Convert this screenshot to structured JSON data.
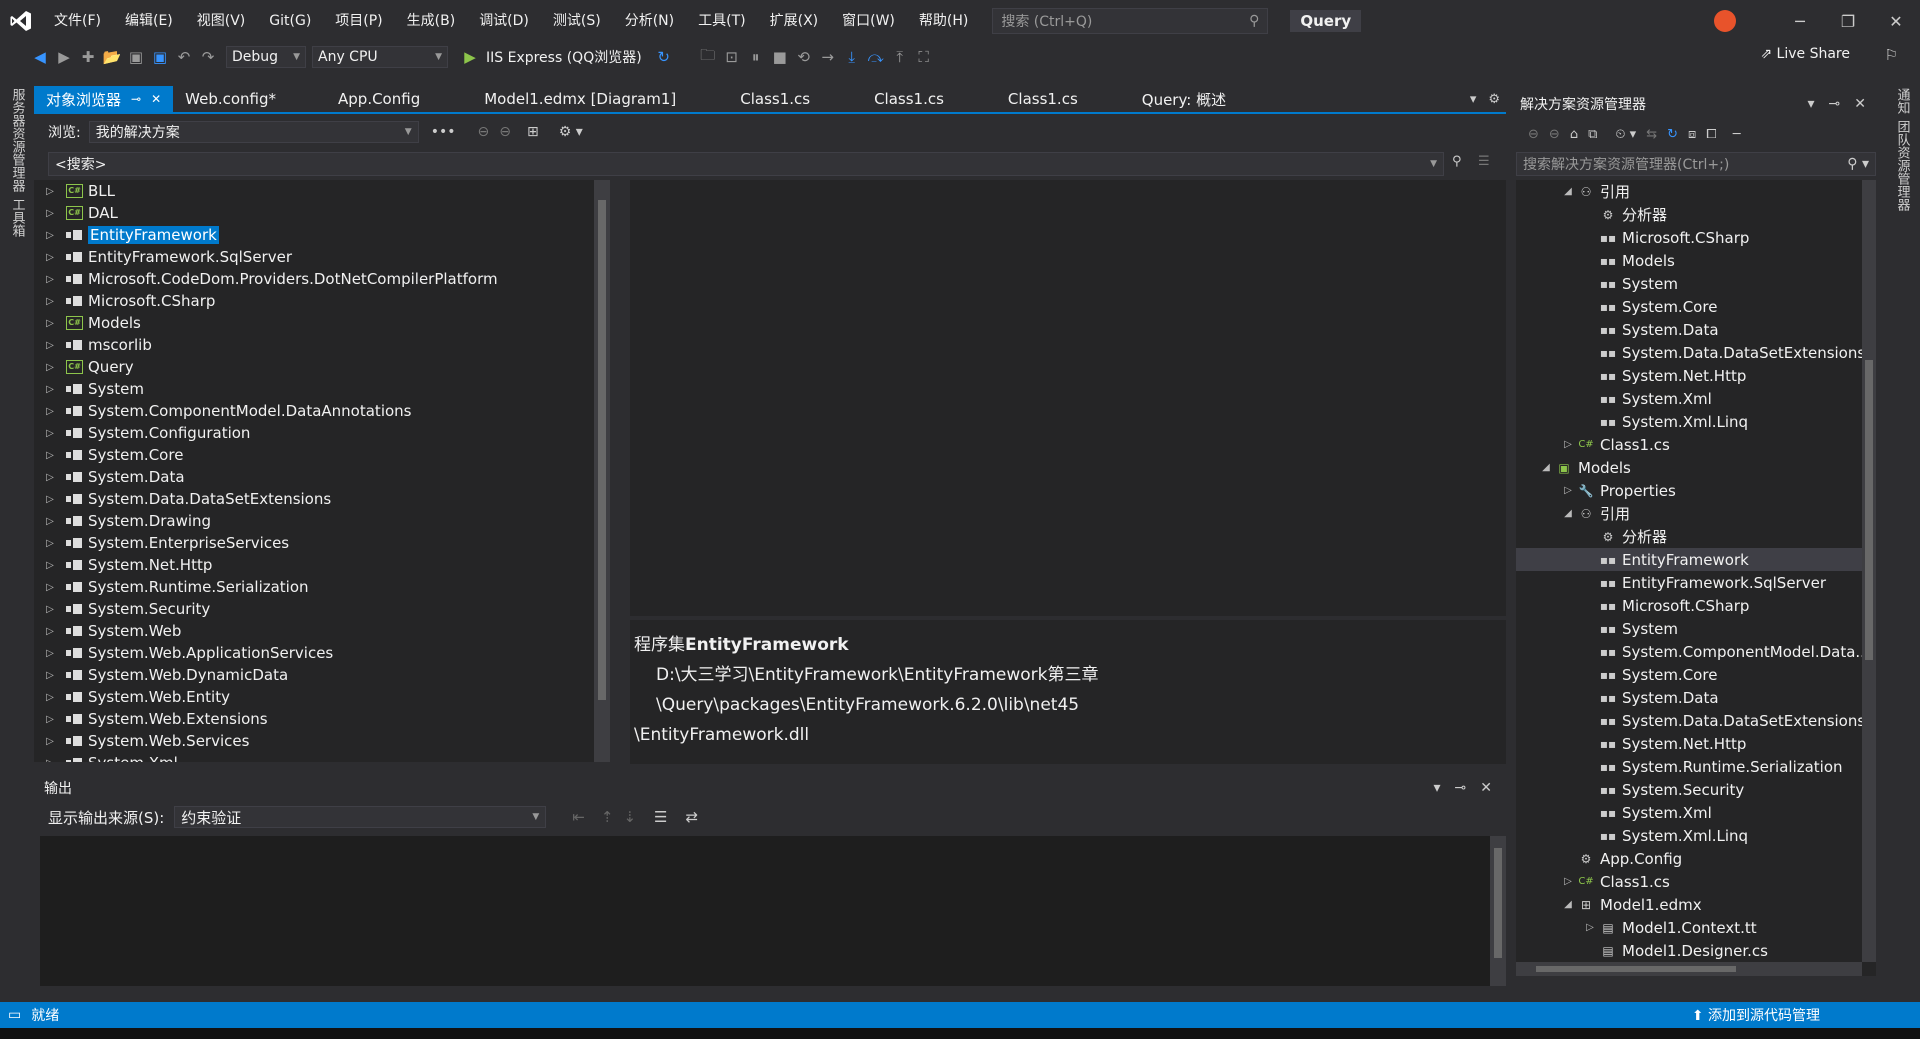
{
  "menu": [
    "文件(F)",
    "编辑(E)",
    "视图(V)",
    "Git(G)",
    "项目(P)",
    "生成(B)",
    "调试(D)",
    "测试(S)",
    "分析(N)",
    "工具(T)",
    "扩展(X)",
    "窗口(W)",
    "帮助(H)"
  ],
  "search": {
    "placeholder": "搜索 (Ctrl+Q)"
  },
  "project_title": "Query",
  "toolbar": {
    "config": "Debug",
    "platform": "Any CPU",
    "run_target": "IIS Express (QQ浏览器)",
    "live_share": "Live Share"
  },
  "left_strip": [
    "服务器资源管理器",
    "工具箱"
  ],
  "right_strip": [
    "通知",
    "团队资源管理器"
  ],
  "tabs": [
    {
      "label": "对象浏览器"
    },
    {
      "label": "Web.config*"
    },
    {
      "label": "App.Config"
    },
    {
      "label": "Model1.edmx [Diagram1]"
    },
    {
      "label": "Class1.cs"
    },
    {
      "label": "Class1.cs"
    },
    {
      "label": "Class1.cs"
    },
    {
      "label": "Query: 概述"
    }
  ],
  "browse": {
    "label": "浏览:",
    "value": "我的解决方案",
    "search_placeholder": "<搜索>"
  },
  "object_tree": [
    {
      "name": "BLL",
      "kind": "cs"
    },
    {
      "name": "DAL",
      "kind": "cs"
    },
    {
      "name": "EntityFramework",
      "kind": "asm",
      "selected": true
    },
    {
      "name": "EntityFramework.SqlServer",
      "kind": "asm"
    },
    {
      "name": "Microsoft.CodeDom.Providers.DotNetCompilerPlatform",
      "kind": "asm"
    },
    {
      "name": "Microsoft.CSharp",
      "kind": "asm"
    },
    {
      "name": "Models",
      "kind": "cs"
    },
    {
      "name": "mscorlib",
      "kind": "asm"
    },
    {
      "name": "Query",
      "kind": "cs"
    },
    {
      "name": "System",
      "kind": "asm"
    },
    {
      "name": "System.ComponentModel.DataAnnotations",
      "kind": "asm"
    },
    {
      "name": "System.Configuration",
      "kind": "asm"
    },
    {
      "name": "System.Core",
      "kind": "asm"
    },
    {
      "name": "System.Data",
      "kind": "asm"
    },
    {
      "name": "System.Data.DataSetExtensions",
      "kind": "asm"
    },
    {
      "name": "System.Drawing",
      "kind": "asm"
    },
    {
      "name": "System.EnterpriseServices",
      "kind": "asm"
    },
    {
      "name": "System.Net.Http",
      "kind": "asm"
    },
    {
      "name": "System.Runtime.Serialization",
      "kind": "asm"
    },
    {
      "name": "System.Security",
      "kind": "asm"
    },
    {
      "name": "System.Web",
      "kind": "asm"
    },
    {
      "name": "System.Web.ApplicationServices",
      "kind": "asm"
    },
    {
      "name": "System.Web.DynamicData",
      "kind": "asm"
    },
    {
      "name": "System.Web.Entity",
      "kind": "asm"
    },
    {
      "name": "System.Web.Extensions",
      "kind": "asm"
    },
    {
      "name": "System.Web.Services",
      "kind": "asm"
    },
    {
      "name": "System.Xml",
      "kind": "asm"
    }
  ],
  "detail": {
    "prefix": "程序集",
    "name": "EntityFramework",
    "path_line1": "D:\\大三学习\\EntityFramework\\EntityFramework第三章\\Query\\packages\\EntityFramework.6.2.0\\lib\\net45",
    "path_line2": "\\EntityFramework.dll"
  },
  "output": {
    "title": "输出",
    "source_label": "显示输出来源(S):",
    "source_value": "约束验证"
  },
  "solution": {
    "title": "解决方案资源管理器",
    "search_placeholder": "搜索解决方案资源管理器(Ctrl+;)",
    "rows": [
      {
        "label": "引用",
        "indent": 2,
        "exp": "◢",
        "icon": "ref"
      },
      {
        "label": "分析器",
        "indent": 3,
        "exp": "",
        "icon": "analyzer"
      },
      {
        "label": "Microsoft.CSharp",
        "indent": 3,
        "exp": "",
        "icon": "asm"
      },
      {
        "label": "Models",
        "indent": 3,
        "exp": "",
        "icon": "asm"
      },
      {
        "label": "System",
        "indent": 3,
        "exp": "",
        "icon": "asm"
      },
      {
        "label": "System.Core",
        "indent": 3,
        "exp": "",
        "icon": "asm"
      },
      {
        "label": "System.Data",
        "indent": 3,
        "exp": "",
        "icon": "asm"
      },
      {
        "label": "System.Data.DataSetExtensions",
        "indent": 3,
        "exp": "",
        "icon": "asm"
      },
      {
        "label": "System.Net.Http",
        "indent": 3,
        "exp": "",
        "icon": "asm"
      },
      {
        "label": "System.Xml",
        "indent": 3,
        "exp": "",
        "icon": "asm"
      },
      {
        "label": "System.Xml.Linq",
        "indent": 3,
        "exp": "",
        "icon": "asm"
      },
      {
        "label": "Class1.cs",
        "indent": 2,
        "exp": "▷",
        "icon": "csfile"
      },
      {
        "label": "Models",
        "indent": 1,
        "exp": "◢",
        "icon": "proj"
      },
      {
        "label": "Properties",
        "indent": 2,
        "exp": "▷",
        "icon": "wrench"
      },
      {
        "label": "引用",
        "indent": 2,
        "exp": "◢",
        "icon": "ref"
      },
      {
        "label": "分析器",
        "indent": 3,
        "exp": "",
        "icon": "analyzer"
      },
      {
        "label": "EntityFramework",
        "indent": 3,
        "exp": "",
        "icon": "asm",
        "highlight": true
      },
      {
        "label": "EntityFramework.SqlServer",
        "indent": 3,
        "exp": "",
        "icon": "asm"
      },
      {
        "label": "Microsoft.CSharp",
        "indent": 3,
        "exp": "",
        "icon": "asm"
      },
      {
        "label": "System",
        "indent": 3,
        "exp": "",
        "icon": "asm"
      },
      {
        "label": "System.ComponentModel.Data...",
        "indent": 3,
        "exp": "",
        "icon": "asm"
      },
      {
        "label": "System.Core",
        "indent": 3,
        "exp": "",
        "icon": "asm"
      },
      {
        "label": "System.Data",
        "indent": 3,
        "exp": "",
        "icon": "asm"
      },
      {
        "label": "System.Data.DataSetExtensions",
        "indent": 3,
        "exp": "",
        "icon": "asm"
      },
      {
        "label": "System.Net.Http",
        "indent": 3,
        "exp": "",
        "icon": "asm"
      },
      {
        "label": "System.Runtime.Serialization",
        "indent": 3,
        "exp": "",
        "icon": "asm"
      },
      {
        "label": "System.Security",
        "indent": 3,
        "exp": "",
        "icon": "asm"
      },
      {
        "label": "System.Xml",
        "indent": 3,
        "exp": "",
        "icon": "asm"
      },
      {
        "label": "System.Xml.Linq",
        "indent": 3,
        "exp": "",
        "icon": "asm"
      },
      {
        "label": "App.Config",
        "indent": 2,
        "exp": "",
        "icon": "config"
      },
      {
        "label": "Class1.cs",
        "indent": 2,
        "exp": "▷",
        "icon": "csfile"
      },
      {
        "label": "Model1.edmx",
        "indent": 2,
        "exp": "◢",
        "icon": "edmx"
      },
      {
        "label": "Model1.Context.tt",
        "indent": 3,
        "exp": "▷",
        "icon": "tt"
      },
      {
        "label": "Model1.Designer.cs",
        "indent": 3,
        "exp": "",
        "icon": "tt"
      }
    ]
  },
  "status": {
    "text": "就绪",
    "right": "添加到源代码管理"
  },
  "colors": {
    "accent": "#007acc",
    "background": "#2d2d30",
    "panel": "#252526"
  }
}
